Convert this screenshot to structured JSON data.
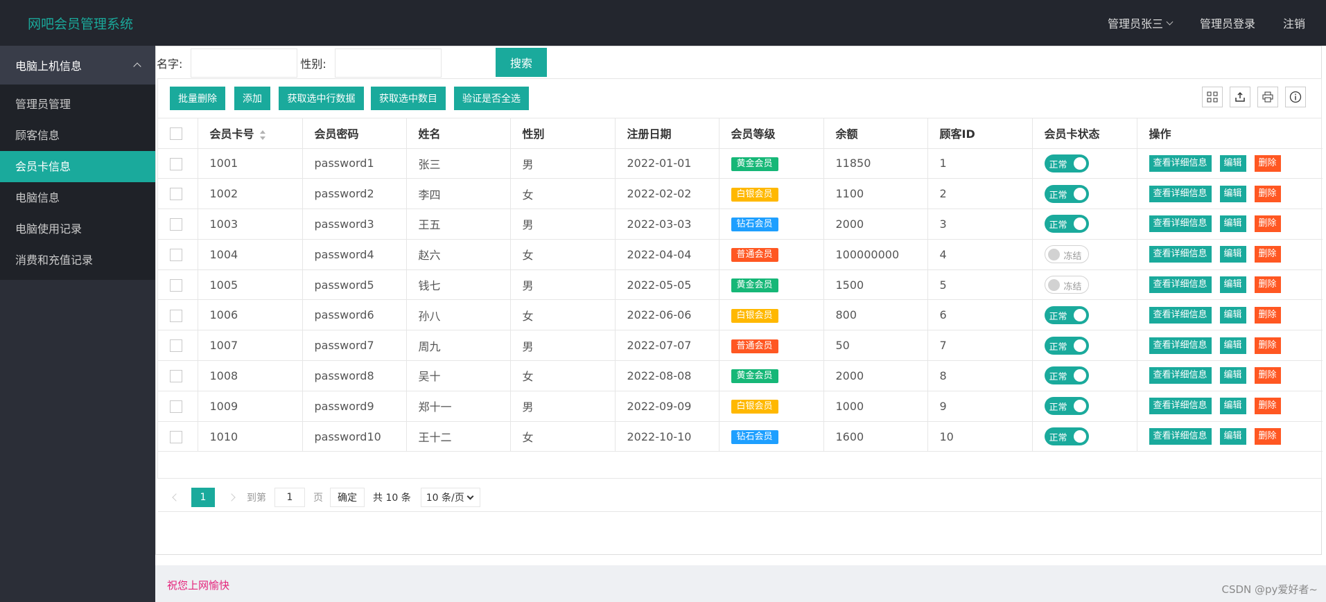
{
  "header": {
    "title": "网吧会员管理系统",
    "admin_name": "管理员张三",
    "admin_login": "管理员登录",
    "logout": "注销"
  },
  "sidebar": {
    "group_label": "电脑上机信息",
    "items": [
      {
        "label": "管理员管理"
      },
      {
        "label": "顾客信息"
      },
      {
        "label": "会员卡信息"
      },
      {
        "label": "电脑信息"
      },
      {
        "label": "电脑使用记录"
      },
      {
        "label": "消费和充值记录"
      }
    ],
    "active_index": 2
  },
  "search": {
    "name_label": "名字:",
    "name_value": "",
    "gender_label": "性别:",
    "gender_value": "",
    "button": "搜索"
  },
  "toolbar": {
    "batch_delete": "批量删除",
    "add": "添加",
    "get_selected_rows": "获取选中行数据",
    "get_selected_count": "获取选中数目",
    "check_all": "验证是否全选",
    "icons": [
      "columns-icon",
      "export-icon",
      "print-icon",
      "info-icon"
    ]
  },
  "table": {
    "columns": [
      "会员卡号",
      "会员密码",
      "姓名",
      "性别",
      "注册日期",
      "会员等级",
      "余额",
      "顾客ID",
      "会员卡状态",
      "操作"
    ],
    "level_colors": {
      "黄金会员": "#16b777",
      "白银会员": "#ffb800",
      "钻石会员": "#1e9fff",
      "普通会员": "#ff5722"
    },
    "status_on": "正常",
    "status_off": "冻结",
    "actions": {
      "view": "查看详细信息",
      "edit": "编辑",
      "delete": "删除"
    },
    "rows": [
      {
        "card": "1001",
        "pwd": "password1",
        "name": "张三",
        "gender": "男",
        "date": "2022-01-01",
        "level": "黄金会员",
        "balance": "11850",
        "cid": "1",
        "active": true
      },
      {
        "card": "1002",
        "pwd": "password2",
        "name": "李四",
        "gender": "女",
        "date": "2022-02-02",
        "level": "白银会员",
        "balance": "1100",
        "cid": "2",
        "active": true
      },
      {
        "card": "1003",
        "pwd": "password3",
        "name": "王五",
        "gender": "男",
        "date": "2022-03-03",
        "level": "钻石会员",
        "balance": "2000",
        "cid": "3",
        "active": true
      },
      {
        "card": "1004",
        "pwd": "password4",
        "name": "赵六",
        "gender": "女",
        "date": "2022-04-04",
        "level": "普通会员",
        "balance": "100000000",
        "cid": "4",
        "active": false
      },
      {
        "card": "1005",
        "pwd": "password5",
        "name": "钱七",
        "gender": "男",
        "date": "2022-05-05",
        "level": "黄金会员",
        "balance": "1500",
        "cid": "5",
        "active": false
      },
      {
        "card": "1006",
        "pwd": "password6",
        "name": "孙八",
        "gender": "女",
        "date": "2022-06-06",
        "level": "白银会员",
        "balance": "800",
        "cid": "6",
        "active": true
      },
      {
        "card": "1007",
        "pwd": "password7",
        "name": "周九",
        "gender": "男",
        "date": "2022-07-07",
        "level": "普通会员",
        "balance": "50",
        "cid": "7",
        "active": true
      },
      {
        "card": "1008",
        "pwd": "password8",
        "name": "吴十",
        "gender": "女",
        "date": "2022-08-08",
        "level": "黄金会员",
        "balance": "2000",
        "cid": "8",
        "active": true
      },
      {
        "card": "1009",
        "pwd": "password9",
        "name": "郑十一",
        "gender": "男",
        "date": "2022-09-09",
        "level": "白银会员",
        "balance": "1000",
        "cid": "9",
        "active": true
      },
      {
        "card": "1010",
        "pwd": "password10",
        "name": "王十二",
        "gender": "女",
        "date": "2022-10-10",
        "level": "钻石会员",
        "balance": "1600",
        "cid": "10",
        "active": true
      }
    ]
  },
  "pager": {
    "current_page": "1",
    "goto_label": "到第",
    "goto_value": "1",
    "page_unit": "页",
    "confirm": "确定",
    "total": "共 10 条",
    "page_size": "10 条/页"
  },
  "footer": {
    "text": "祝您上网愉快",
    "watermark": "CSDN @py爱好者~"
  }
}
